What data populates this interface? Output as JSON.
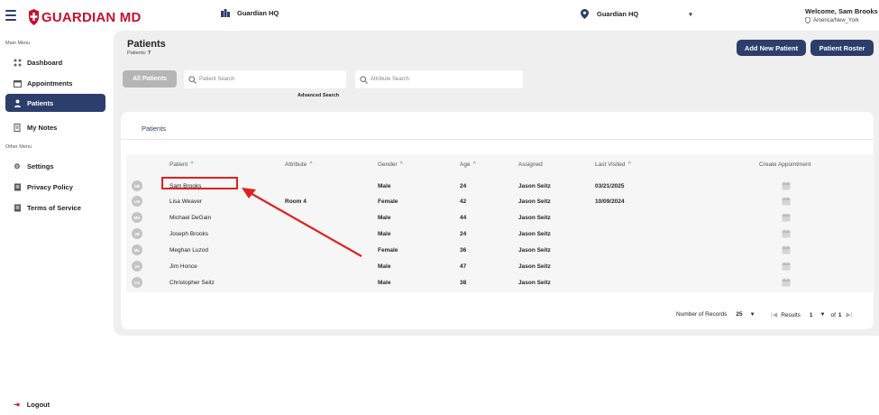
{
  "header": {
    "brand": "GUARDIAN MD",
    "org": "Guardian HQ",
    "location_select": "Guardian HQ",
    "welcome": "Welcome, Sam Brooks",
    "timezone": "America/New_York"
  },
  "sidebar": {
    "main_menu_heading": "Main Menu",
    "items": [
      {
        "label": "Dashboard",
        "icon": "dashboard-icon"
      },
      {
        "label": "Appointments",
        "icon": "calendar-icon"
      },
      {
        "label": "Patients",
        "icon": "user-icon",
        "active": true
      },
      {
        "label": "My Notes",
        "icon": "notes-icon"
      }
    ],
    "other_menu_heading": "Other Menu",
    "other_items": [
      {
        "label": "Settings",
        "icon": "gear-icon"
      },
      {
        "label": "Privacy Policy",
        "icon": "document-icon"
      },
      {
        "label": "Terms of Service",
        "icon": "document-icon"
      }
    ],
    "logout": "Logout"
  },
  "page": {
    "title": "Patients",
    "subtitle_label": "Patients:",
    "count": "7",
    "add_button": "Add New Patient",
    "roster_button": "Patient Roster",
    "all_patients_tab": "All Patients",
    "patient_search_placeholder": "Patient Search",
    "attribute_search_placeholder": "Attribute Search",
    "advanced_search": "Advanced Search",
    "card_tab": "Patients"
  },
  "table": {
    "headers": {
      "patient": "Patient",
      "attribute": "Attribute",
      "gender": "Gender",
      "age": "Age",
      "assigned": "Assigned",
      "last_visited": "Last Visited",
      "create_appointment": "Create Appointment"
    },
    "rows": [
      {
        "initials": "SB",
        "name": "Sam Brooks",
        "attribute": "",
        "gender": "Male",
        "age": "24",
        "assigned": "Jason Seitz",
        "last_visited": "03/21/2025"
      },
      {
        "initials": "LW",
        "name": "Lisa Weaver",
        "attribute": "Room 4",
        "gender": "Female",
        "age": "42",
        "assigned": "Jason Seitz",
        "last_visited": "10/09/2024"
      },
      {
        "initials": "MD",
        "name": "Michael DeGain",
        "attribute": "",
        "gender": "Male",
        "age": "44",
        "assigned": "Jason Seitz",
        "last_visited": ""
      },
      {
        "initials": "JB",
        "name": "Joseph Brooks",
        "attribute": "",
        "gender": "Male",
        "age": "24",
        "assigned": "Jason Seitz",
        "last_visited": ""
      },
      {
        "initials": "ML",
        "name": "Meghan Luzod",
        "attribute": "",
        "gender": "Female",
        "age": "36",
        "assigned": "Jason Seitz",
        "last_visited": ""
      },
      {
        "initials": "JH",
        "name": "Jim Honce",
        "attribute": "",
        "gender": "Male",
        "age": "47",
        "assigned": "Jason Seitz",
        "last_visited": ""
      },
      {
        "initials": "CS",
        "name": "Christopher Seitz",
        "attribute": "",
        "gender": "Male",
        "age": "38",
        "assigned": "Jason Seitz",
        "last_visited": ""
      }
    ]
  },
  "pagination": {
    "records_label": "Number of Records",
    "records_value": "25",
    "results_label": "Results",
    "page_value": "1",
    "of_label": "of",
    "total_pages": "1"
  },
  "colors": {
    "brand_red": "#c8102e",
    "navy": "#2c3e6b",
    "annotation_red": "#e0201f"
  }
}
